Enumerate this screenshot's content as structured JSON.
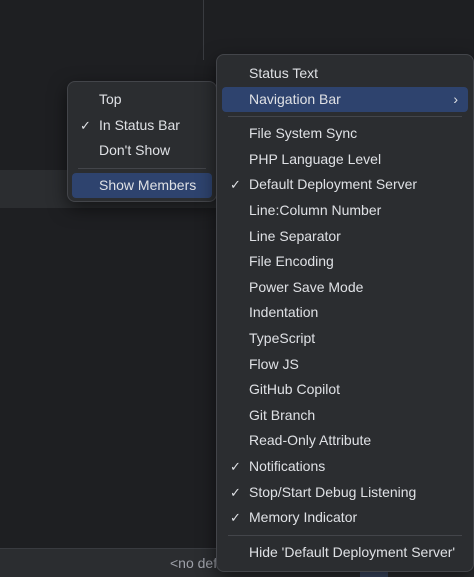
{
  "status_bar": {
    "text": "<no def"
  },
  "left_menu": {
    "items": [
      {
        "label": "Top",
        "checked": false
      },
      {
        "label": "In Status Bar",
        "checked": true
      },
      {
        "label": "Don't Show",
        "checked": false
      }
    ],
    "footer_item": {
      "label": "Show Members",
      "selected": true
    }
  },
  "right_menu": {
    "top_items": [
      {
        "label": "Status Text",
        "checked": false
      },
      {
        "label": "Navigation Bar",
        "checked": false,
        "submenu": true,
        "selected": true
      }
    ],
    "items": [
      {
        "label": "File System Sync",
        "checked": false
      },
      {
        "label": "PHP Language Level",
        "checked": false
      },
      {
        "label": "Default Deployment Server",
        "checked": true
      },
      {
        "label": "Line:Column Number",
        "checked": false
      },
      {
        "label": "Line Separator",
        "checked": false
      },
      {
        "label": "File Encoding",
        "checked": false
      },
      {
        "label": "Power Save Mode",
        "checked": false
      },
      {
        "label": "Indentation",
        "checked": false
      },
      {
        "label": "TypeScript",
        "checked": false
      },
      {
        "label": "Flow JS",
        "checked": false
      },
      {
        "label": "GitHub Copilot",
        "checked": false
      },
      {
        "label": "Git Branch",
        "checked": false
      },
      {
        "label": "Read-Only Attribute",
        "checked": false
      },
      {
        "label": "Notifications",
        "checked": true
      },
      {
        "label": "Stop/Start Debug Listening",
        "checked": true
      },
      {
        "label": "Memory Indicator",
        "checked": true
      }
    ],
    "hide_item": {
      "label": "Hide 'Default Deployment Server'"
    }
  },
  "icons": {
    "check": "✓",
    "submenu_arrow": "›"
  },
  "colors": {
    "background": "#1e1f22",
    "menu_background": "#2b2d30",
    "selection": "#2e436e",
    "text": "#dfe1e5"
  }
}
